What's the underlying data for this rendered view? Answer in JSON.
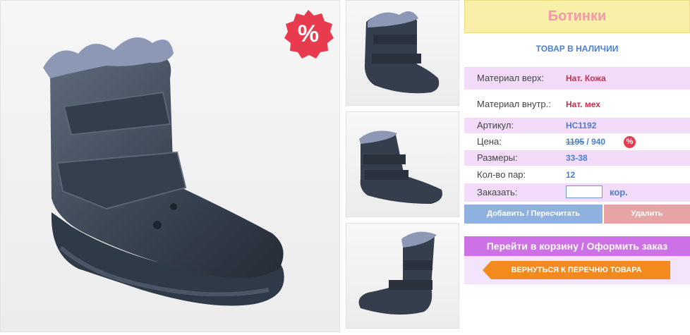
{
  "product": {
    "title": "Ботинки",
    "stock_status": "ТОВАР В НАЛИЧИИ",
    "sale_badge": "%"
  },
  "details": [
    {
      "label": "Материал верх:",
      "value": "Нат. Кожа"
    },
    {
      "label": "Материал внутр.:",
      "value": "Нат. мех"
    },
    {
      "label": "Артикул:",
      "value": "HC1192"
    },
    {
      "label": "Цена:",
      "old_price": "1195",
      "separator": " / ",
      "new_price": "940"
    },
    {
      "label": "Размеры:",
      "value": "33-38"
    },
    {
      "label": "Кол-во пар:",
      "value": "12"
    },
    {
      "label": "Заказать:",
      "input_value": "",
      "unit": "кор."
    }
  ],
  "buttons": {
    "add": "Добавить / Пересчитать",
    "delete": "Удалить",
    "cart": "Перейти в корзину / Оформить заказ",
    "back": "ВЕРНУТЬСЯ К ПЕРЕЧНЮ ТОВАРА"
  },
  "colors": {
    "title_bg": "#f9efa8",
    "title_text": "#ef9aa6",
    "accent_blue": "#4a7fcf",
    "accent_red": "#c6304a",
    "row_pink": "#f2dcfa",
    "cart_button": "#cf71e6",
    "back_button": "#f28a1e"
  },
  "icons": [
    "sale-percent-icon",
    "discount-percent-icon",
    "boot-image"
  ]
}
